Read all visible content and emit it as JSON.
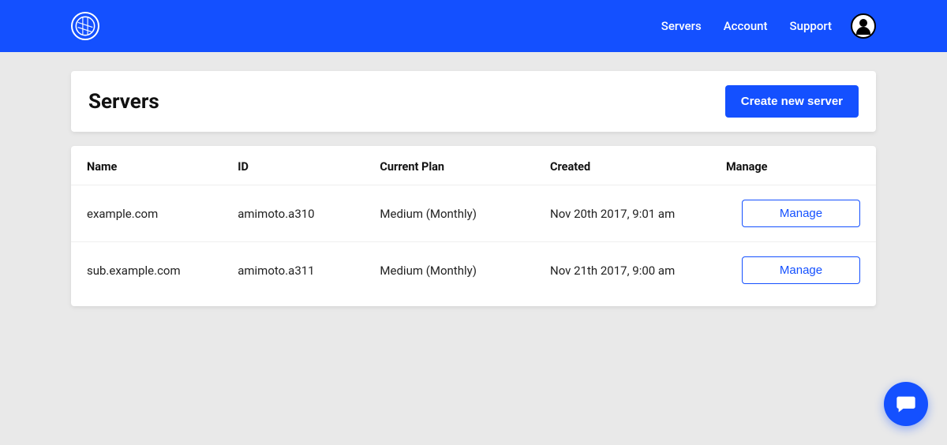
{
  "nav": {
    "links": [
      "Servers",
      "Account",
      "Support"
    ]
  },
  "header": {
    "title": "Servers",
    "create_label": "Create new server"
  },
  "table": {
    "columns": [
      "Name",
      "ID",
      "Current Plan",
      "Created",
      "Manage"
    ],
    "rows": [
      {
        "name": "example.com",
        "id": "amimoto.a310",
        "plan": "Medium (Monthly)",
        "created": "Nov 20th 2017, 9:01 am",
        "manage_label": "Manage"
      },
      {
        "name": "sub.example.com",
        "id": "amimoto.a311",
        "plan": "Medium (Monthly)",
        "created": "Nov 21th 2017, 9:00 am",
        "manage_label": "Manage"
      }
    ]
  }
}
